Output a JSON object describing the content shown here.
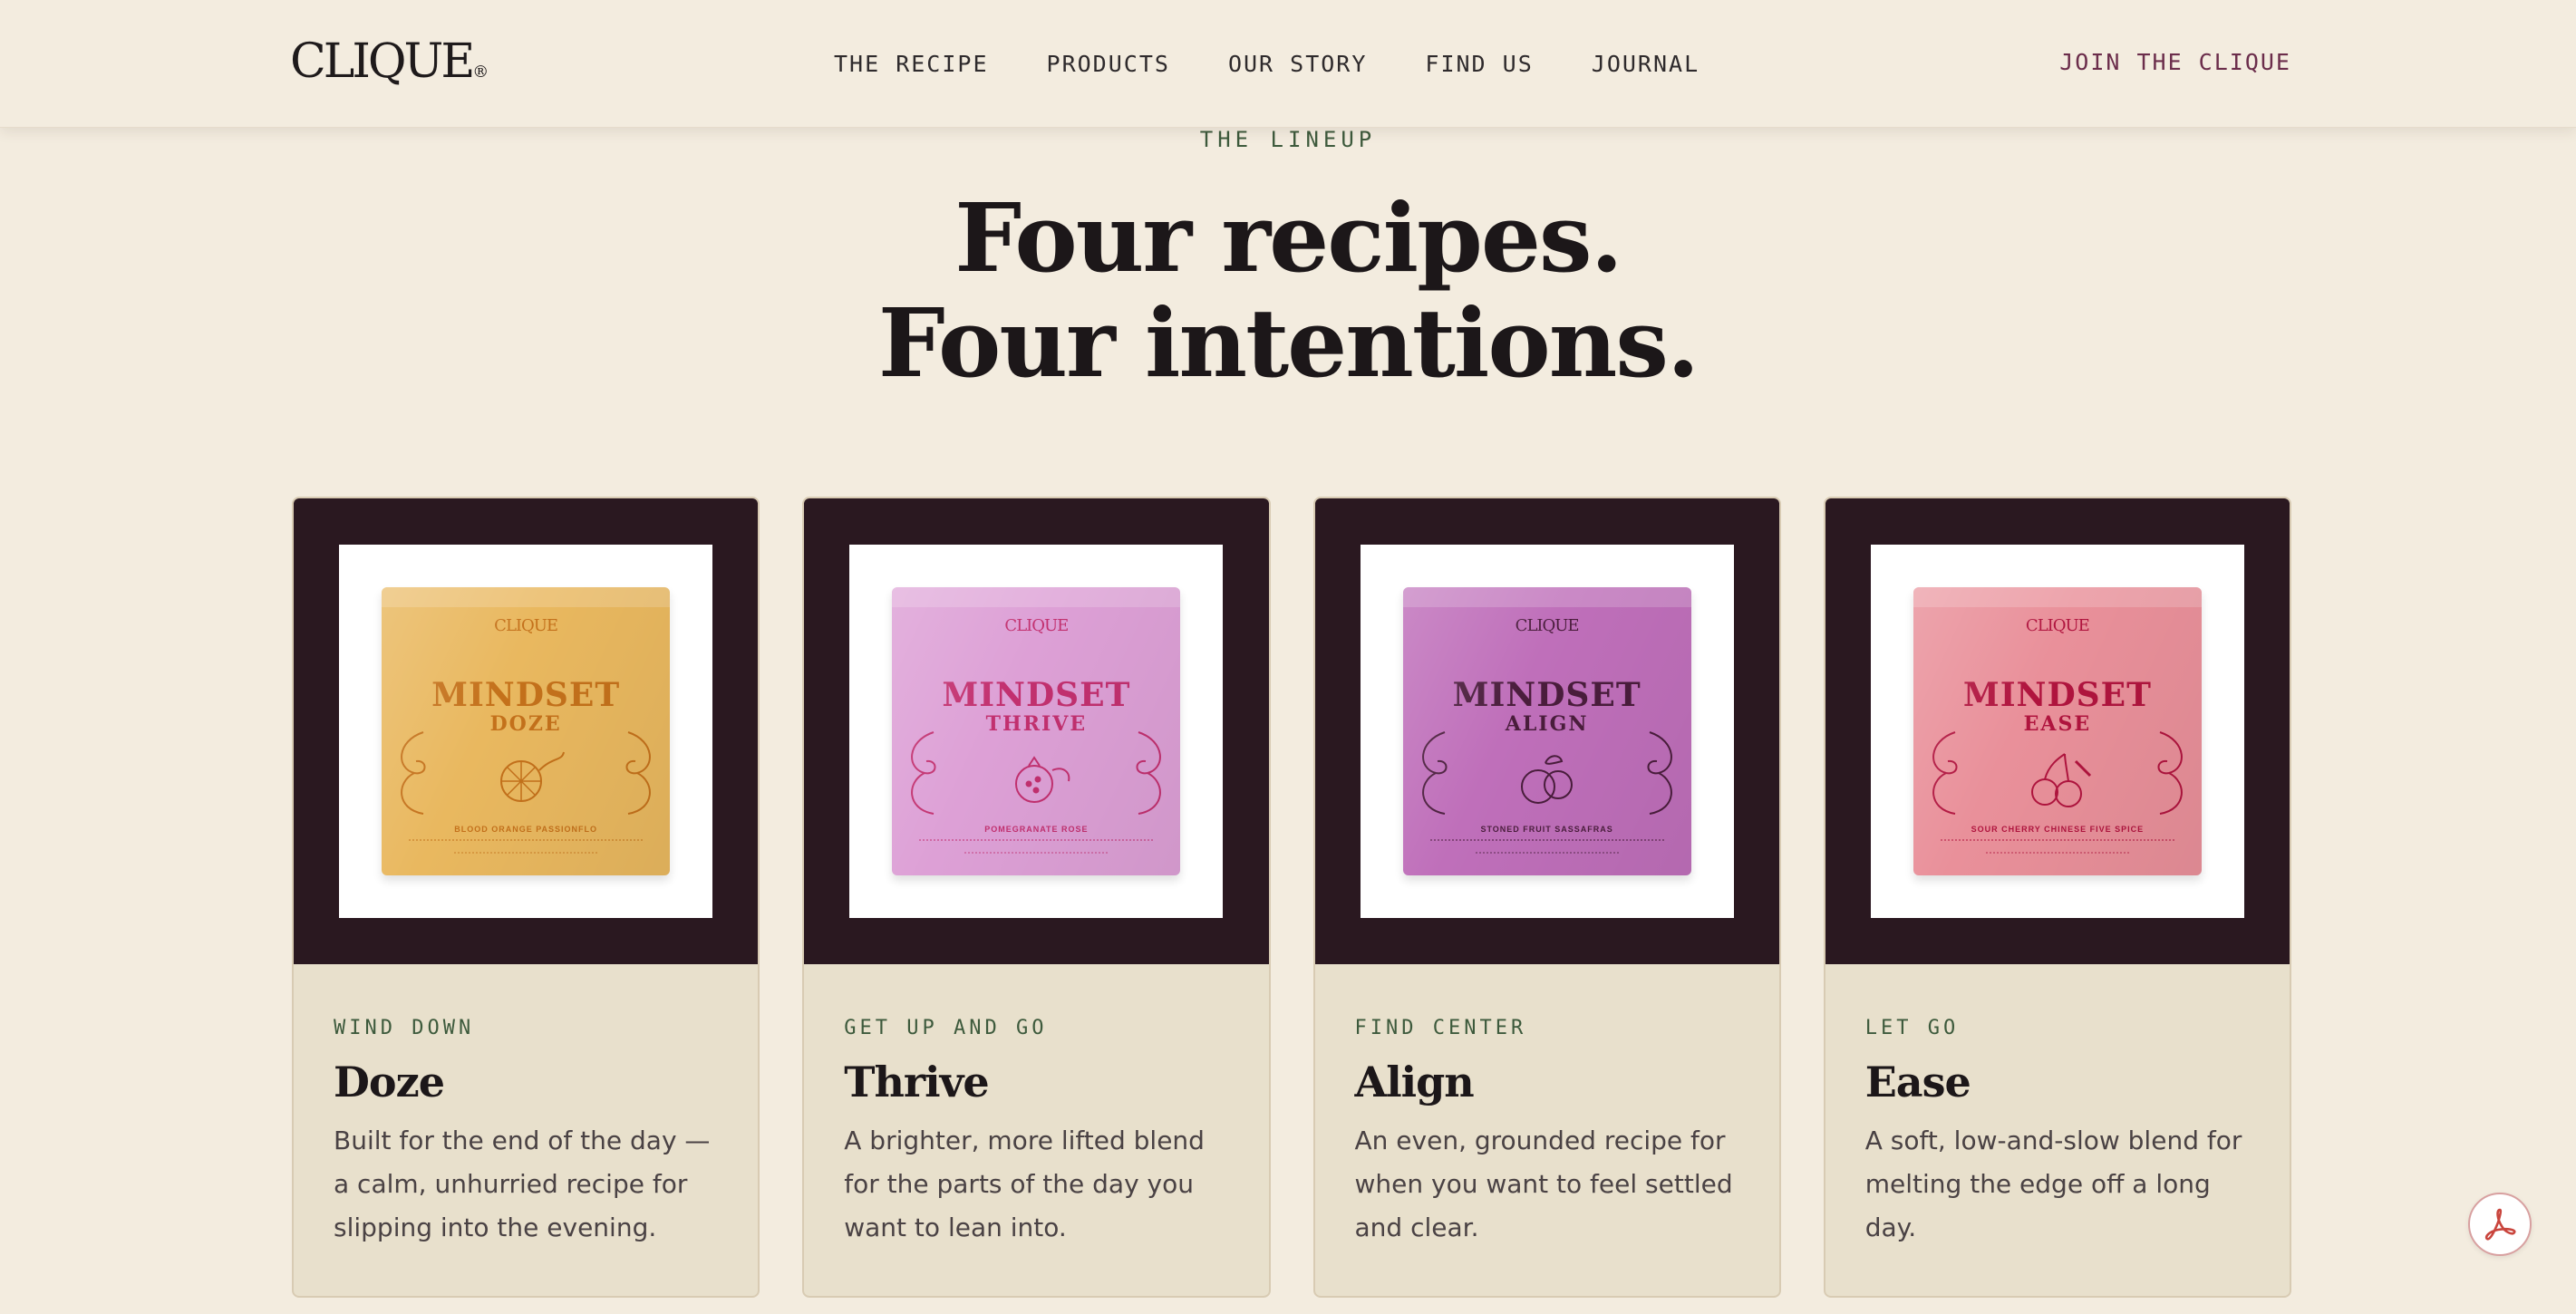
{
  "header": {
    "logo": "CLIQUE",
    "logo_mark": "®",
    "nav": [
      {
        "label": "THE RECIPE"
      },
      {
        "label": "PRODUCTS"
      },
      {
        "label": "OUR STORY"
      },
      {
        "label": "FIND US"
      },
      {
        "label": "JOURNAL"
      }
    ],
    "cta": "JOIN THE CLIQUE"
  },
  "hero": {
    "eyebrow": "THE LINEUP",
    "headline_line1": "Four recipes.",
    "headline_line2": "Four intentions."
  },
  "products": [
    {
      "tag": "WIND DOWN",
      "title": "Doze",
      "description": "Built for the end of the day — a calm, unhurried recipe for slipping into the evening.",
      "pouch": {
        "logo": "CLIQUE",
        "brand": "MINDSET",
        "name": "DOZE",
        "flavor": "BLOOD ORANGE PASSIONFLO",
        "color": "#e9b85f",
        "ink": "#c4711b"
      }
    },
    {
      "tag": "GET UP AND GO",
      "title": "Thrive",
      "description": "A brighter, more lifted blend for the parts of the day you want to lean into.",
      "pouch": {
        "logo": "CLIQUE",
        "brand": "MINDSET",
        "name": "THRIVE",
        "flavor": "POMEGRANATE ROSE",
        "color": "#dda0d6",
        "ink": "#c2306f"
      }
    },
    {
      "tag": "FIND CENTER",
      "title": "Align",
      "description": "An even, grounded recipe for when you want to feel settled and clear.",
      "pouch": {
        "logo": "CLIQUE",
        "brand": "MINDSET",
        "name": "ALIGN",
        "flavor": "STONED FRUIT SASSAFRAS",
        "color": "#bf6fba",
        "ink": "#4a1d3c"
      }
    },
    {
      "tag": "LET GO",
      "title": "Ease",
      "description": "A soft, low-and-slow blend for melting the edge off a long day.",
      "pouch": {
        "logo": "CLIQUE",
        "brand": "MINDSET",
        "name": "EASE",
        "flavor": "SOUR CHERRY CHINESE FIVE SPICE",
        "color": "#e9909a",
        "ink": "#b0143e"
      }
    }
  ],
  "fab": {
    "icon": "acrobat-pdf-icon",
    "color": "#c9453d"
  }
}
